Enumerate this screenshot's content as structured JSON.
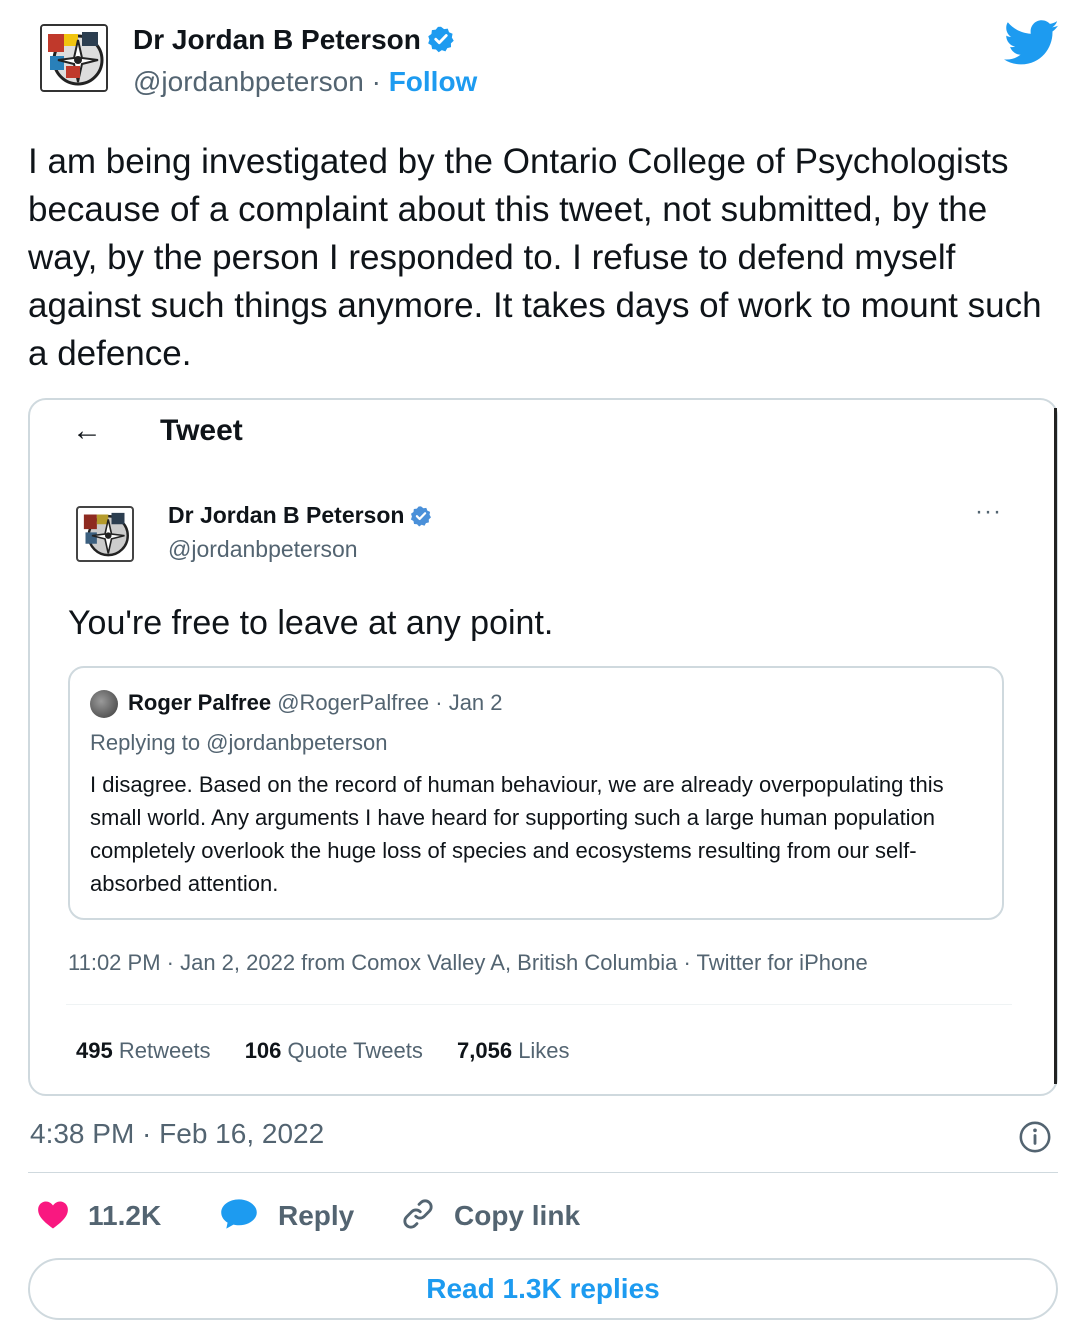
{
  "author": {
    "name": "Dr Jordan B Peterson",
    "handle": "@jordanbpeterson",
    "separator": "·",
    "follow_label": "Follow"
  },
  "tweet": {
    "text": "I am being investigated by the Ontario College of Psychologists because of a complaint about this tweet, not submitted, by the way, by the person I responded to. I refuse to defend myself against such things anymore. It takes days of work to mount such a defence."
  },
  "embedded": {
    "back_arrow": "←",
    "header": "Tweet",
    "more": "···",
    "author_name": "Dr Jordan B Peterson",
    "author_handle": "@jordanbpeterson",
    "text": "You're free to leave at any point.",
    "quote": {
      "name": "Roger Palfree",
      "handle_date": "@RogerPalfree · Jan 2",
      "replying_to": "Replying to @jordanbpeterson",
      "text": "I disagree. Based on the record of human behaviour, we are already overpopulating this small world. Any arguments I have heard for supporting such a large human population completely overlook the huge loss of species and ecosystems resulting from our self-absorbed attention."
    },
    "meta": "11:02 PM · Jan 2, 2022 from Comox Valley A, British Columbia · Twitter for iPhone",
    "stats": {
      "retweets_count": "495",
      "retweets_label": "Retweets",
      "quotes_count": "106",
      "quotes_label": "Quote Tweets",
      "likes_count": "7,056",
      "likes_label": "Likes"
    }
  },
  "footer": {
    "timestamp": "4:38 PM · Feb 16, 2022",
    "like_count": "11.2K",
    "reply_label": "Reply",
    "copy_label": "Copy link",
    "read_replies": "Read 1.3K replies"
  },
  "colors": {
    "accent": "#1d9bf0",
    "like": "#f91880",
    "text": "#0f1419",
    "muted": "#536471",
    "border": "#cfd9de"
  },
  "icons": [
    "verified-badge-icon",
    "twitter-bird-icon",
    "back-arrow-icon",
    "more-icon",
    "info-icon",
    "heart-icon",
    "reply-bubble-icon",
    "link-icon"
  ]
}
